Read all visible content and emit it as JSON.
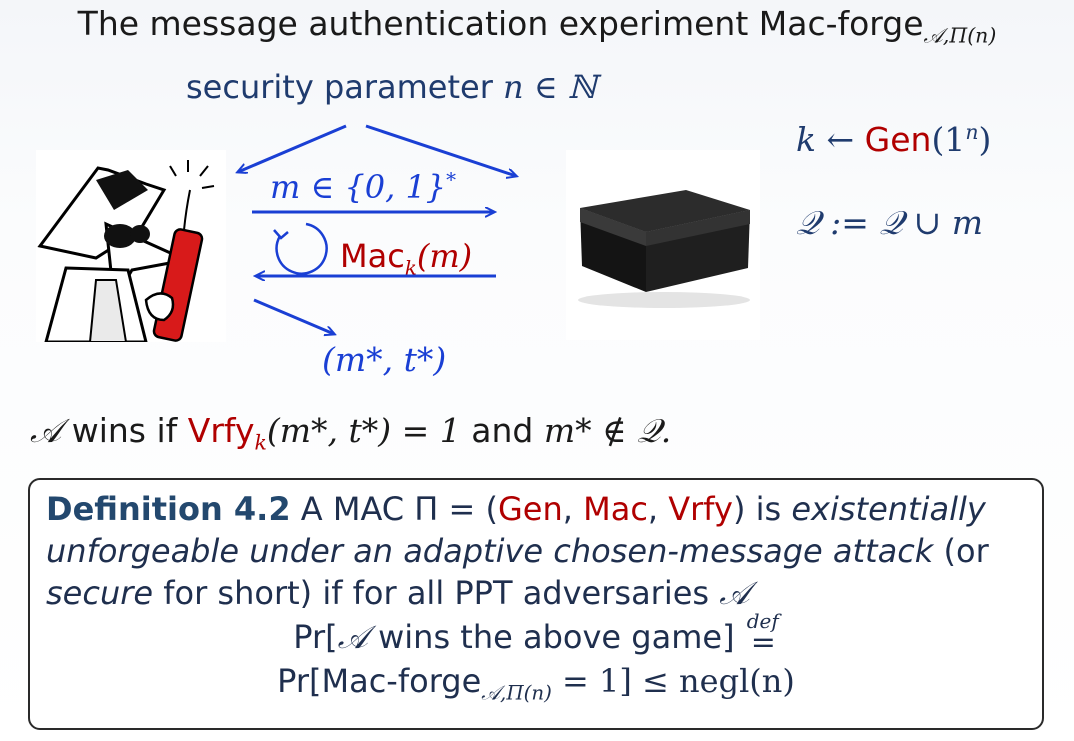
{
  "title": {
    "prefix": "The message authentication experiment Mac-forge",
    "subscript": "𝒜,Π(n)"
  },
  "security_param": {
    "label": "security parameter",
    "math": "n ∈ ℕ"
  },
  "oracle": {
    "gen_lhs": "k ←",
    "gen_fn": "Gen",
    "gen_arg": "(1",
    "gen_sup": "n",
    "gen_close": ")",
    "q_update": "𝒬 := 𝒬 ∪ m"
  },
  "arrows": {
    "query_label": "m ∈ {0, 1}",
    "query_sup": "*",
    "mac_fn": "Mac",
    "mac_sub": "k",
    "mac_arg": "(m)",
    "forge_label": "(m*, t*)"
  },
  "win_condition": {
    "adversary": "𝒜",
    "text1": "wins if",
    "vrfy": "Vrfy",
    "vrfy_sub": "k",
    "math1": "(m*, t*) = 1",
    "text2": "and",
    "math2": "m* ∉ 𝒬."
  },
  "definition": {
    "heading": "Definition 4.2",
    "line1_a": "A MAC Π = (",
    "gen": "Gen",
    "comma1": ", ",
    "mac": "Mac",
    "comma2": ", ",
    "vrfy": "Vrfy",
    "line1_b": ") is ",
    "italic1": "existentially unforgeable under an adaptive chosen-message attack",
    "text2": " (or ",
    "italic2": "secure",
    "text3": " for short) if for all PPT adversaries ",
    "adversary": "𝒜",
    "prob1_a": "Pr[",
    "prob1_adv": "𝒜",
    "prob1_b": " wins the above game]",
    "def_label": "def",
    "def_eq": "=",
    "prob2_a": "Pr[Mac-forge",
    "prob2_sub": "𝒜,Π(n)",
    "prob2_b": " = 1] ≤ negl(n)"
  },
  "colors": {
    "accent_red": "#b00000",
    "arrow_blue": "#1a3fd4",
    "text_navy": "#1f2f4e"
  }
}
